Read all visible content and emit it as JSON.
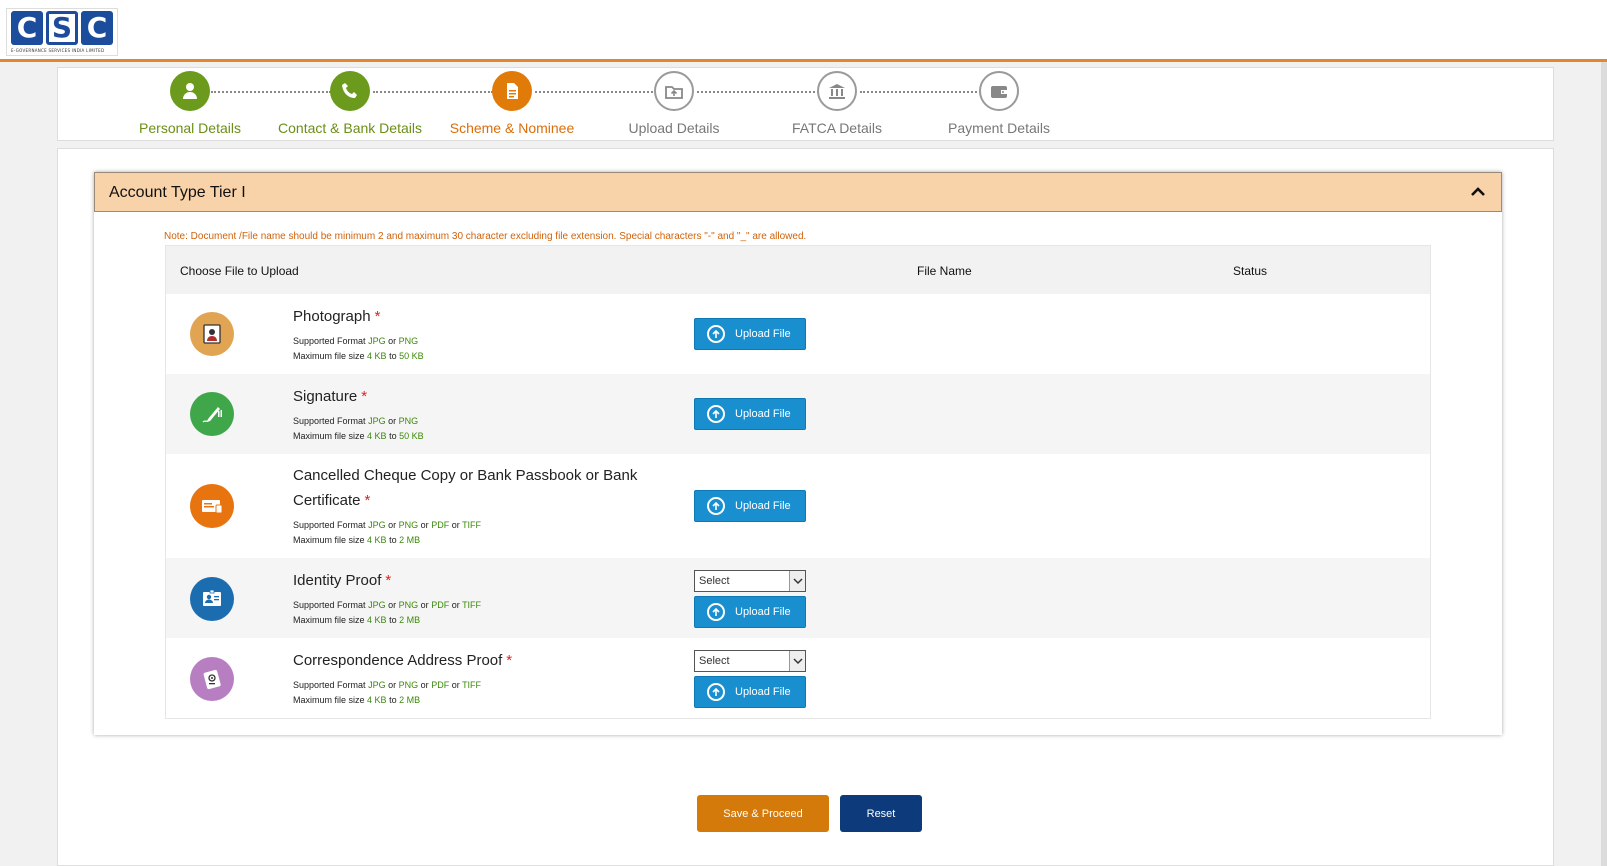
{
  "logo": {
    "letters": [
      "C",
      "S",
      "C"
    ],
    "tagline": "E-GOVERNANCE SERVICES INDIA LIMITED"
  },
  "stepper": {
    "steps": [
      {
        "label": "Personal Details",
        "icon": "user-icon",
        "state": "completed"
      },
      {
        "label": "Contact & Bank Details",
        "icon": "phone-icon",
        "state": "completed"
      },
      {
        "label": "Scheme & Nominee",
        "icon": "document-icon",
        "state": "active"
      },
      {
        "label": "Upload Details",
        "icon": "upload-folder-icon",
        "state": "pending"
      },
      {
        "label": "FATCA Details",
        "icon": "bank-icon",
        "state": "pending"
      },
      {
        "label": "Payment Details",
        "icon": "wallet-icon",
        "state": "pending"
      }
    ]
  },
  "accordion": {
    "title": "Account Type Tier I"
  },
  "note": "Note: Document /File name should be minimum 2 and maximum 30 character excluding file extension. Special characters \"-\" and \"_\" are allowed.",
  "table": {
    "headers": {
      "choose": "Choose File to Upload",
      "file_name": "File Name",
      "status": "Status"
    },
    "rows": [
      {
        "title": "Photograph",
        "formats": [
          "JPG",
          "PNG"
        ],
        "min": "4 KB",
        "max": "50 KB",
        "icon": "photo-id-icon",
        "icon_color": "#e1a452",
        "has_select": false
      },
      {
        "title": "Signature",
        "formats": [
          "JPG",
          "PNG"
        ],
        "min": "4 KB",
        "max": "50 KB",
        "icon": "signature-pen-icon",
        "icon_color": "#3fa64a",
        "has_select": false
      },
      {
        "title_line1": "Cancelled Cheque Copy or Bank Passbook or Bank",
        "title_line2": "Certificate",
        "formats": [
          "JPG",
          "PNG",
          "PDF",
          "TIFF"
        ],
        "min": "4 KB",
        "max": "2 MB",
        "icon": "cheque-icon",
        "icon_color": "#e8740f",
        "has_select": false
      },
      {
        "title": "Identity Proof",
        "formats": [
          "JPG",
          "PNG",
          "PDF",
          "TIFF"
        ],
        "min": "4 KB",
        "max": "2 MB",
        "icon": "id-card-icon",
        "icon_color": "#1c6cb0",
        "has_select": true
      },
      {
        "title": "Correspondence Address Proof",
        "formats": [
          "JPG",
          "PNG",
          "PDF",
          "TIFF"
        ],
        "min": "4 KB",
        "max": "2 MB",
        "icon": "address-book-icon",
        "icon_color": "#b77fc2",
        "has_select": true
      }
    ],
    "supported_label": "Supported Format",
    "or_label": "or",
    "max_label": "Maximum file size",
    "to_label": "to",
    "required_mark": "*",
    "upload_label": "Upload File",
    "select_value": "Select"
  },
  "buttons": {
    "save": "Save & Proceed",
    "reset": "Reset"
  },
  "colors": {
    "accent_orange": "#e07b0a",
    "green": "#6b9a1c",
    "upload_blue": "#1a8fd0",
    "reset_navy": "#0d3a7a"
  }
}
